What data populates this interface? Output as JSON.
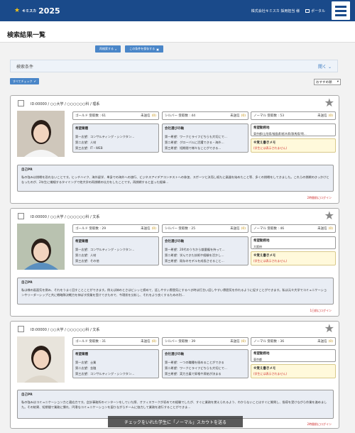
{
  "header": {
    "brand": "キミスカ",
    "year": "2025",
    "company": "株式会社キミスカ 採用担当 様",
    "portal": "ポータル"
  },
  "page": {
    "title": "検索結果一覧"
  },
  "toolbar": {
    "research": "再検索する",
    "save": "この条件を保存する"
  },
  "conditions": {
    "label": "検索条件",
    "open": "開く"
  },
  "check_all": "すべてチェック",
  "sort": "おすすめ順",
  "footer_action": "チェックをいれた学生に「ノーマル」スカウトを送る",
  "labels": {
    "gold": "ゴールド 受取数",
    "silver": "シルバー 受取数",
    "normal": "ノーマル 受取数",
    "unsent": "未送信",
    "zero": "(0)",
    "industry": "希望業種",
    "axis": "会社選びの軸",
    "location": "希望勤務地",
    "memo": "※覚え書きメモ",
    "memo_empty": "(学生には表示されません)",
    "pr": "自己PR"
  },
  "colors": {
    "header": "#1a4a8a",
    "accent": "#4a86c8",
    "alert": "#d03030"
  },
  "students": [
    {
      "id": "ID:00000 / ○○大学 / ○○○○○○科 / 理系",
      "gold": "61",
      "silver": "44",
      "normal": "53",
      "industry": [
        "第一志望：コンサルティング・シンクタン…",
        "第二志望：人材",
        "第三志望：IT・WEB"
      ],
      "axis": [
        "第一希望：ワークとライフどちらも大切にで…",
        "第二希望：グローバルに活躍できる・海外…",
        "第三希望：短期間で様々なことができる…"
      ],
      "location": "東京都/山形県/福島県/栃木県/群馬県/埼…",
      "pr": "私の強みは挑戦を恐れないことです。ヒッチハイク、海外留学、単身での海外への旅行、ビジネスアイデアコンテストへの参加、スポーツと決而し紙たに楽器を始めたこと等、多くの挑戦をしてきました。これらの挑戦のきっかけとなったのが、2年生に繊細するタイミングで他大学の再挑戦の仕方をしたことです。再挑戦すると並った経緯…",
      "login": "2時間前にログイン"
    },
    {
      "id": "ID:00000 / ○○大学 / ○○○○○○科 / 文系",
      "gold": "29",
      "silver": "25",
      "normal": "46",
      "industry": [
        "第一志望：コンサルティング・シンクタン…",
        "第二志望：人材",
        "第三志望：その他"
      ],
      "axis": [
        "第一希望：20代のうちから裁量権を持って…",
        "第二希望：学んできた技術や経験を活かし…",
        "第三希望：既存のモデルを成長させること…"
      ],
      "location": "大阪府",
      "pr": "私は様の画面気を倒み、それをうまく回すことことができます。例えば姉のとさはビシッと締めて、話しやすい雰囲気にするべき時は打言い話しやすい雰囲気を作れるように促すことができます。私は元々大学でコミュニケーションやリーダーシップと共に戦略隊決戦力を伸ばす授業を受けてきたので、今現状を分析し、それをより良くするための判…",
      "login": "1日前にログイン"
    },
    {
      "id": "ID:00000 / ○○大学 / ○○○○○○科 / 文系",
      "gold": "31",
      "silver": "39",
      "normal": "36",
      "industry": [
        "第一志望：士業",
        "第二志望：金融",
        "第三志望：コンサルティング・シンクタン…"
      ],
      "axis": [
        "第一希望：一つの職種を極めることができる",
        "第二希望：ワークとライフどちらも大切にで…",
        "第三希望：実力主義で昇格や昇給が決まる"
      ],
      "location": "東京都",
      "pr": "私の強みはコミュニケーション力と適応力です。会計事務所のインターンをしていた際、オフィスワークが初めての経験でしたが、すぐに業務を覚えられるよう、わからないことはすぐに質問し、指導を受けながら作業を進めました。その結果、短期間で業務に慣れ、円滑なコミュニケーションを図りながらチームに協力して業務を遂行することができま…",
      "login": "2時間前にログイン"
    }
  ]
}
